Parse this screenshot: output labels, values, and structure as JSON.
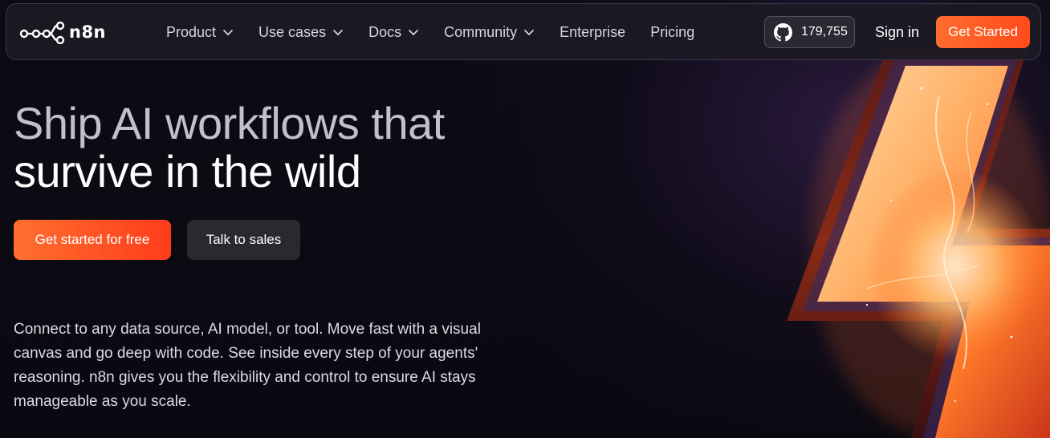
{
  "brand": {
    "name": "n8n"
  },
  "nav": {
    "items": [
      {
        "label": "Product",
        "has_dropdown": true
      },
      {
        "label": "Use cases",
        "has_dropdown": true
      },
      {
        "label": "Docs",
        "has_dropdown": true
      },
      {
        "label": "Community",
        "has_dropdown": true
      },
      {
        "label": "Enterprise",
        "has_dropdown": false
      },
      {
        "label": "Pricing",
        "has_dropdown": false
      }
    ],
    "github": {
      "icon": "github-icon",
      "stars": "179,755"
    },
    "signin_label": "Sign in",
    "cta_label": "Get Started"
  },
  "hero": {
    "title_line1": "Ship AI workflows that",
    "title_line2": "survive in the wild",
    "primary_button": "Get started for free",
    "secondary_button": "Talk to sales",
    "description": "Connect to any data source, AI model, or tool. Move fast with a visual canvas and go deep with code. See inside every step of your agents' reasoning. n8n gives you the flexibility and control to ensure AI stays manageable as you scale."
  },
  "colors": {
    "background": "#0b0912",
    "accent": "#ff5a24",
    "nav_background": "#1c1a24",
    "secondary_button": "#2a2930"
  }
}
